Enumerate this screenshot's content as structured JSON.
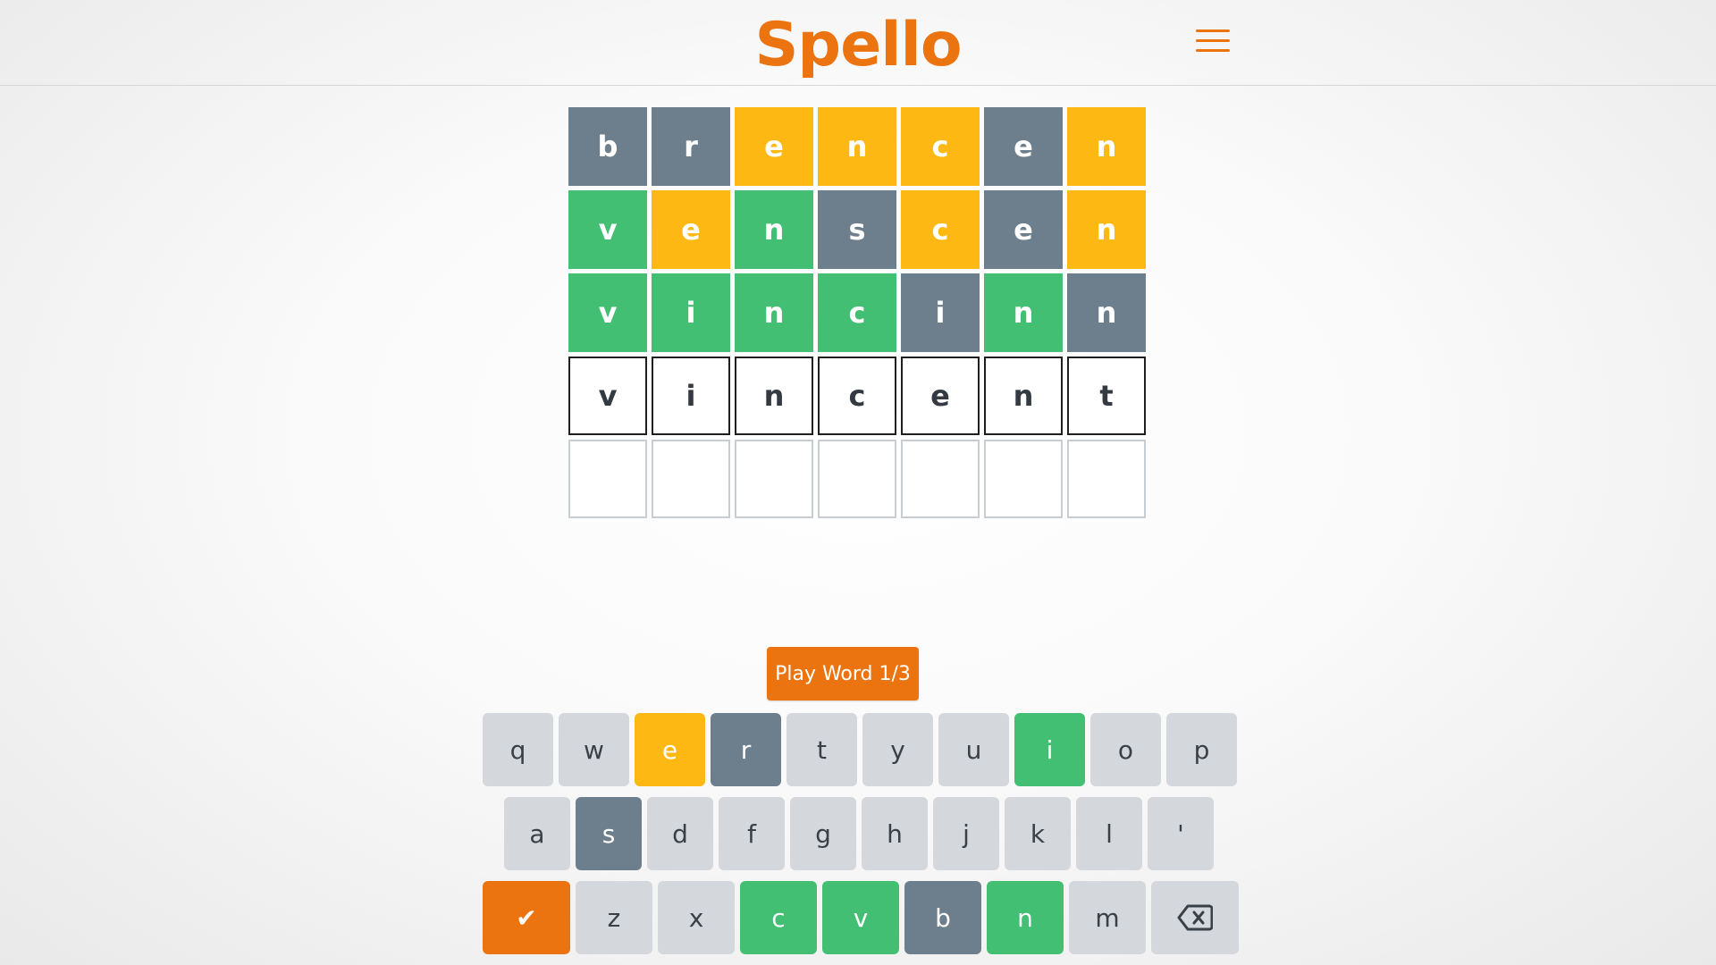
{
  "header": {
    "title": "Spello",
    "menu_icon": "hamburger-menu-icon"
  },
  "colors": {
    "accent": "#ec7410",
    "correct": "#42bf72",
    "present": "#fdb813",
    "absent": "#6d7e8c",
    "unused_key": "#d4d8dc"
  },
  "board": {
    "rows": [
      [
        {
          "letter": "b",
          "state": "gray"
        },
        {
          "letter": "r",
          "state": "gray"
        },
        {
          "letter": "e",
          "state": "yellow"
        },
        {
          "letter": "n",
          "state": "yellow"
        },
        {
          "letter": "c",
          "state": "yellow"
        },
        {
          "letter": "e",
          "state": "gray"
        },
        {
          "letter": "n",
          "state": "yellow"
        }
      ],
      [
        {
          "letter": "v",
          "state": "green"
        },
        {
          "letter": "e",
          "state": "yellow"
        },
        {
          "letter": "n",
          "state": "green"
        },
        {
          "letter": "s",
          "state": "gray"
        },
        {
          "letter": "c",
          "state": "yellow"
        },
        {
          "letter": "e",
          "state": "gray"
        },
        {
          "letter": "n",
          "state": "yellow"
        }
      ],
      [
        {
          "letter": "v",
          "state": "green"
        },
        {
          "letter": "i",
          "state": "green"
        },
        {
          "letter": "n",
          "state": "green"
        },
        {
          "letter": "c",
          "state": "green"
        },
        {
          "letter": "i",
          "state": "gray"
        },
        {
          "letter": "n",
          "state": "green"
        },
        {
          "letter": "n",
          "state": "gray"
        }
      ],
      [
        {
          "letter": "v",
          "state": "active"
        },
        {
          "letter": "i",
          "state": "active"
        },
        {
          "letter": "n",
          "state": "active"
        },
        {
          "letter": "c",
          "state": "active"
        },
        {
          "letter": "e",
          "state": "active"
        },
        {
          "letter": "n",
          "state": "active"
        },
        {
          "letter": "t",
          "state": "active"
        }
      ],
      [
        {
          "letter": "",
          "state": "empty"
        },
        {
          "letter": "",
          "state": "empty"
        },
        {
          "letter": "",
          "state": "empty"
        },
        {
          "letter": "",
          "state": "empty"
        },
        {
          "letter": "",
          "state": "empty"
        },
        {
          "letter": "",
          "state": "empty"
        },
        {
          "letter": "",
          "state": "empty"
        }
      ]
    ]
  },
  "play_button": {
    "label": "Play Word 1/3"
  },
  "keyboard": {
    "rows": [
      [
        {
          "key": "q",
          "state": "default"
        },
        {
          "key": "w",
          "state": "default"
        },
        {
          "key": "e",
          "state": "yellow"
        },
        {
          "key": "r",
          "state": "gray"
        },
        {
          "key": "t",
          "state": "default"
        },
        {
          "key": "y",
          "state": "default"
        },
        {
          "key": "u",
          "state": "default"
        },
        {
          "key": "i",
          "state": "green"
        },
        {
          "key": "o",
          "state": "default"
        },
        {
          "key": "p",
          "state": "default"
        }
      ],
      [
        {
          "key": "a",
          "state": "default"
        },
        {
          "key": "s",
          "state": "gray"
        },
        {
          "key": "d",
          "state": "default"
        },
        {
          "key": "f",
          "state": "default"
        },
        {
          "key": "g",
          "state": "default"
        },
        {
          "key": "h",
          "state": "default"
        },
        {
          "key": "j",
          "state": "default"
        },
        {
          "key": "k",
          "state": "default"
        },
        {
          "key": "l",
          "state": "default"
        },
        {
          "key": "'",
          "state": "default"
        }
      ],
      [
        {
          "key": "✔",
          "state": "orange",
          "name": "enter-check-icon",
          "wide": true
        },
        {
          "key": "z",
          "state": "default"
        },
        {
          "key": "x",
          "state": "default"
        },
        {
          "key": "c",
          "state": "green"
        },
        {
          "key": "v",
          "state": "green"
        },
        {
          "key": "b",
          "state": "gray"
        },
        {
          "key": "n",
          "state": "green"
        },
        {
          "key": "m",
          "state": "default"
        },
        {
          "key": "",
          "state": "default",
          "name": "backspace-icon",
          "wide": true
        }
      ]
    ]
  }
}
